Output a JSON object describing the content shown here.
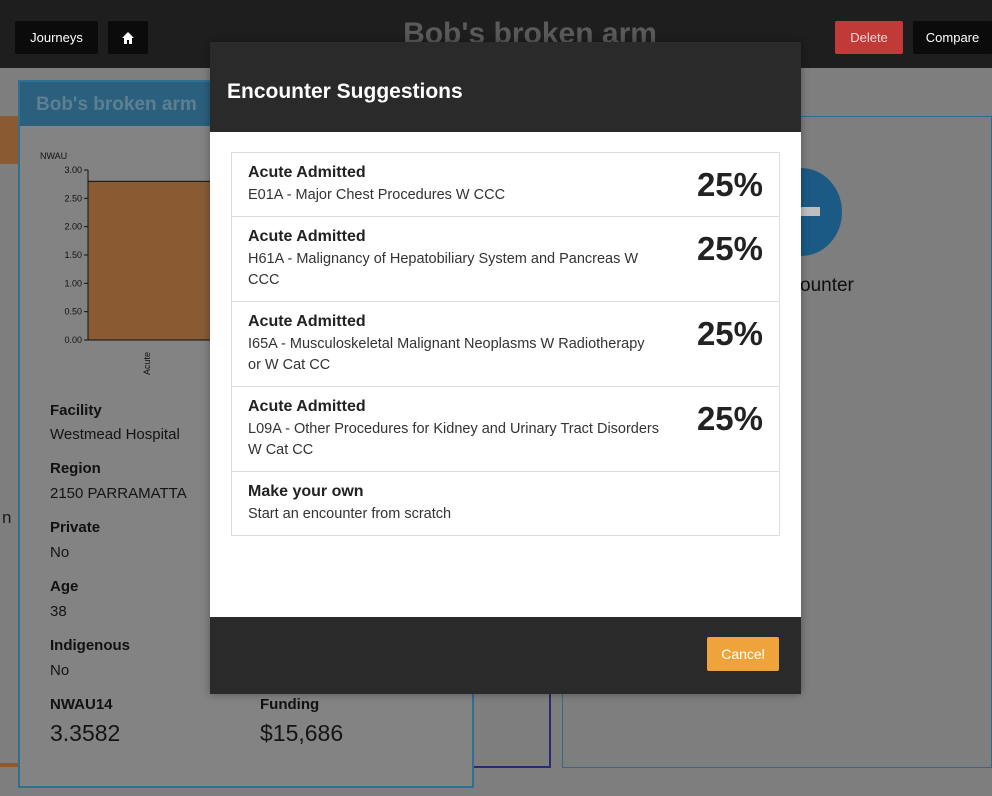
{
  "topbar": {
    "journeys_label": "Journeys",
    "home_icon": "home-icon",
    "title": "Bob's broken arm",
    "delete_label": "Delete",
    "compare_label": "Compare"
  },
  "background": {
    "encounter_partial": "ounter",
    "left_partial": "n"
  },
  "card": {
    "title": "Bob's broken arm",
    "fields": [
      {
        "label": "Facility",
        "value": "Westmead Hospital"
      },
      {
        "label": "Region",
        "value": "2150 PARRAMATTA"
      },
      {
        "label": "Private",
        "value": "No"
      },
      {
        "label": "Age",
        "value": "38"
      },
      {
        "label": "Indigenous",
        "value": "No"
      }
    ],
    "nwau_label": "NWAU14",
    "nwau_value": "3.3582",
    "funding_label": "Funding",
    "funding_value": "$15,686"
  },
  "chart_data": {
    "type": "bar",
    "ylabel": "NWAU",
    "ylim": [
      0,
      3.0
    ],
    "yticks": [
      "0.00",
      "0.50",
      "1.00",
      "1.50",
      "2.00",
      "2.50",
      "3.00"
    ],
    "categories": [
      "Acute"
    ],
    "values": [
      2.8
    ],
    "bar_color": "#8a5b33"
  },
  "modal": {
    "title": "Encounter Suggestions",
    "suggestions": [
      {
        "type": "Acute Admitted",
        "desc": "E01A - Major Chest Procedures W CCC",
        "pct": "25%"
      },
      {
        "type": "Acute Admitted",
        "desc": "H61A - Malignancy of Hepatobiliary System and Pancreas W CCC",
        "pct": "25%"
      },
      {
        "type": "Acute Admitted",
        "desc": "I65A - Musculoskeletal Malignant Neoplasms W Radiotherapy or W Cat CC",
        "pct": "25%"
      },
      {
        "type": "Acute Admitted",
        "desc": "L09A - Other Procedures for Kidney and Urinary Tract Disorders W Cat CC",
        "pct": "25%"
      }
    ],
    "custom": {
      "type": "Make your own",
      "desc": "Start an encounter from scratch"
    },
    "cancel_label": "Cancel"
  },
  "colors": {
    "delete": "#c23a37",
    "cancel": "#eea43b",
    "header_dark": "#2a2a2a"
  }
}
